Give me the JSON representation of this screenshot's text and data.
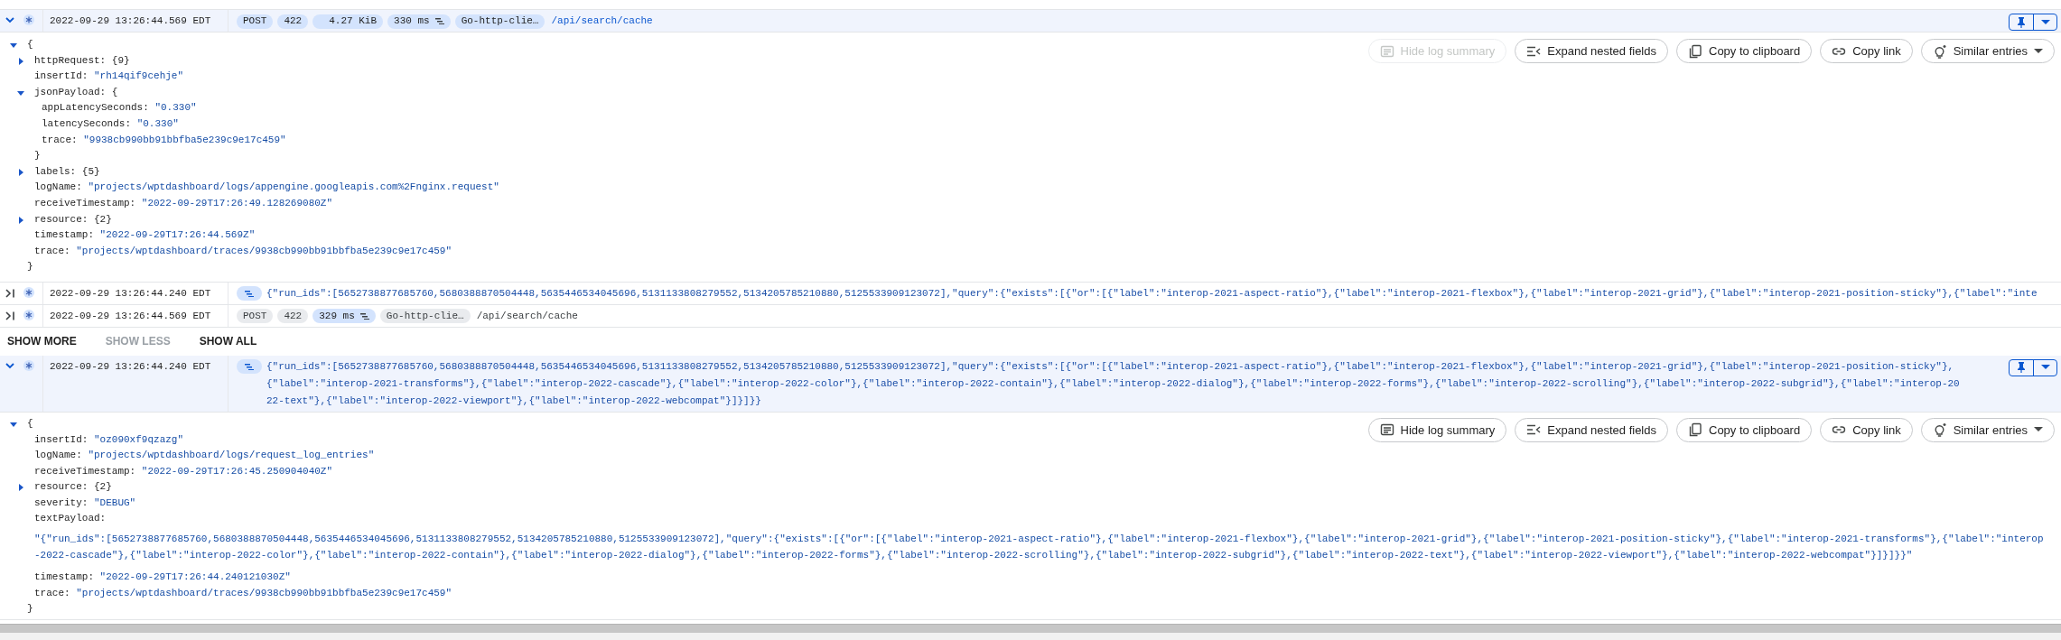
{
  "entries": [
    {
      "kind": "request",
      "timestamp": "2022-09-29 13:26:44.569 EDT",
      "expanded": true,
      "correlated": false,
      "chips": [
        {
          "text": "POST",
          "kind": "field"
        },
        {
          "text": "422",
          "kind": "field"
        },
        {
          "text": "4.27 KiB",
          "kind": "size"
        },
        {
          "text": "330 ms",
          "kind": "latency"
        },
        {
          "text": "Go-http-clie…",
          "kind": "field"
        }
      ],
      "path": "/api/search/cache",
      "details": {
        "actions": [
          {
            "label": "Hide log summary",
            "kind": "summary",
            "disabled": true
          },
          {
            "label": "Expand nested fields",
            "kind": "expand",
            "disabled": false
          },
          {
            "label": "Copy to clipboard",
            "kind": "copy",
            "disabled": false
          },
          {
            "label": "Copy link",
            "kind": "link",
            "disabled": false
          },
          {
            "label": "Similar entries",
            "kind": "similar",
            "disabled": false
          }
        ],
        "tree": {
          "open": "{",
          "close": "}",
          "expanded": true,
          "children": [
            {
              "key": "httpRequest:",
              "summary": "{9}",
              "expanded": false
            },
            {
              "key": "insertId:",
              "value": "\"rh14qif9cehje\""
            },
            {
              "key": "jsonPayload:",
              "open": "{",
              "close": "}",
              "expanded": true,
              "children": [
                {
                  "key": "appLatencySeconds:",
                  "value": "\"0.330\""
                },
                {
                  "key": "latencySeconds:",
                  "value": "\"0.330\""
                },
                {
                  "key": "trace:",
                  "value": "\"9938cb990bb91bbfba5e239c9e17c459\""
                }
              ]
            },
            {
              "key": "labels:",
              "summary": "{5}",
              "expanded": false
            },
            {
              "key": "logName:",
              "value": "\"projects/wptdashboard/logs/appengine.googleapis.com%2Fnginx.request\""
            },
            {
              "key": "receiveTimestamp:",
              "value": "\"2022-09-29T17:26:49.128269080Z\""
            },
            {
              "key": "resource:",
              "summary": "{2}",
              "expanded": false
            },
            {
              "key": "timestamp:",
              "value": "\"2022-09-29T17:26:44.569Z\""
            },
            {
              "key": "trace:",
              "value": "\"projects/wptdashboard/traces/9938cb990bb91bbfba5e239c9e17c459\""
            }
          ]
        }
      }
    },
    {
      "kind": "text",
      "timestamp": "2022-09-29 13:26:44.240 EDT",
      "expanded": false,
      "correlated": true,
      "summary": "{\"run_ids\":[5652738877685760,5680388870504448,5635446534045696,5131133808279552,5134205785210880,5125533909123072],\"query\":{\"exists\":[{\"or\":[{\"label\":\"interop-2021-aspect-ratio\"},{\"label\":\"interop-2021-flexbox\"},{\"label\":\"interop-2021-grid\"},{\"label\":\"interop-2021-position-sticky\"},{\"label\":\"inte"
    },
    {
      "kind": "request",
      "timestamp": "2022-09-29 13:26:44.569 EDT",
      "expanded": false,
      "correlated": true,
      "chips": [
        {
          "text": "POST",
          "kind": "field"
        },
        {
          "text": "422",
          "kind": "field"
        },
        {
          "text": "329 ms",
          "kind": "latency"
        },
        {
          "text": "Go-http-clie…",
          "kind": "field"
        }
      ],
      "path": "/api/search/cache"
    },
    {
      "kind": "pager",
      "buttons": [
        {
          "label": "SHOW MORE",
          "disabled": false
        },
        {
          "label": "SHOW LESS",
          "disabled": true
        },
        {
          "label": "SHOW ALL",
          "disabled": false
        }
      ]
    },
    {
      "kind": "text",
      "timestamp": "2022-09-29 13:26:44.240 EDT",
      "expanded": true,
      "correlated": false,
      "summary": "{\"run_ids\":[5652738877685760,5680388870504448,5635446534045696,5131133808279552,5134205785210880,5125533909123072],\"query\":{\"exists\":[{\"or\":[{\"label\":\"interop-2021-aspect-ratio\"},{\"label\":\"interop-2021-flexbox\"},{\"label\":\"interop-2021-grid\"},{\"label\":\"interop-2021-position-sticky\"},{\"label\":\"interop-2021-transforms\"},{\"label\":\"interop-2022-cascade\"},{\"label\":\"interop-2022-color\"},{\"label\":\"interop-2022-contain\"},{\"label\":\"interop-2022-dialog\"},{\"label\":\"interop-2022-forms\"},{\"label\":\"interop-2022-scrolling\"},{\"label\":\"interop-2022-subgrid\"},{\"label\":\"interop-2022-text\"},{\"label\":\"interop-2022-viewport\"},{\"label\":\"interop-2022-webcompat\"}]}]}}",
      "details": {
        "actions": [
          {
            "label": "Hide log summary",
            "kind": "summary",
            "disabled": false
          },
          {
            "label": "Expand nested fields",
            "kind": "expand",
            "disabled": false
          },
          {
            "label": "Copy to clipboard",
            "kind": "copy",
            "disabled": false
          },
          {
            "label": "Copy link",
            "kind": "link",
            "disabled": false
          },
          {
            "label": "Similar entries",
            "kind": "similar",
            "disabled": false
          }
        ],
        "tree": {
          "open": "{",
          "close": "}",
          "expanded": true,
          "children": [
            {
              "key": "insertId:",
              "value": "\"oz090xf9qzazg\""
            },
            {
              "key": "logName:",
              "value": "\"projects/wptdashboard/logs/request_log_entries\""
            },
            {
              "key": "receiveTimestamp:",
              "value": "\"2022-09-29T17:26:45.250904040Z\""
            },
            {
              "key": "resource:",
              "summary": "{2}",
              "expanded": false
            },
            {
              "key": "severity:",
              "value": "\"DEBUG\""
            },
            {
              "key": "textPayload:",
              "value_below": true,
              "value": "\"{\"run_ids\":[5652738877685760,5680388870504448,5635446534045696,5131133808279552,5134205785210880,5125533909123072],\"query\":{\"exists\":[{\"or\":[{\"label\":\"interop-2021-aspect-ratio\"},{\"label\":\"interop-2021-flexbox\"},{\"label\":\"interop-2021-grid\"},{\"label\":\"interop-2021-position-sticky\"},{\"label\":\"interop-2021-transforms\"},{\"label\":\"interop-2022-cascade\"},{\"label\":\"interop-2022-color\"},{\"label\":\"interop-2022-contain\"},{\"label\":\"interop-2022-dialog\"},{\"label\":\"interop-2022-forms\"},{\"label\":\"interop-2022-scrolling\"},{\"label\":\"interop-2022-subgrid\"},{\"label\":\"interop-2022-text\"},{\"label\":\"interop-2022-viewport\"},{\"label\":\"interop-2022-webcompat\"}]}]}}\""
            },
            {
              "key": "timestamp:",
              "value": "\"2022-09-29T17:26:44.240121030Z\""
            },
            {
              "key": "trace:",
              "value": "\"projects/wptdashboard/traces/9938cb990bb91bbfba5e239c9e17c459\""
            }
          ]
        }
      }
    }
  ]
}
